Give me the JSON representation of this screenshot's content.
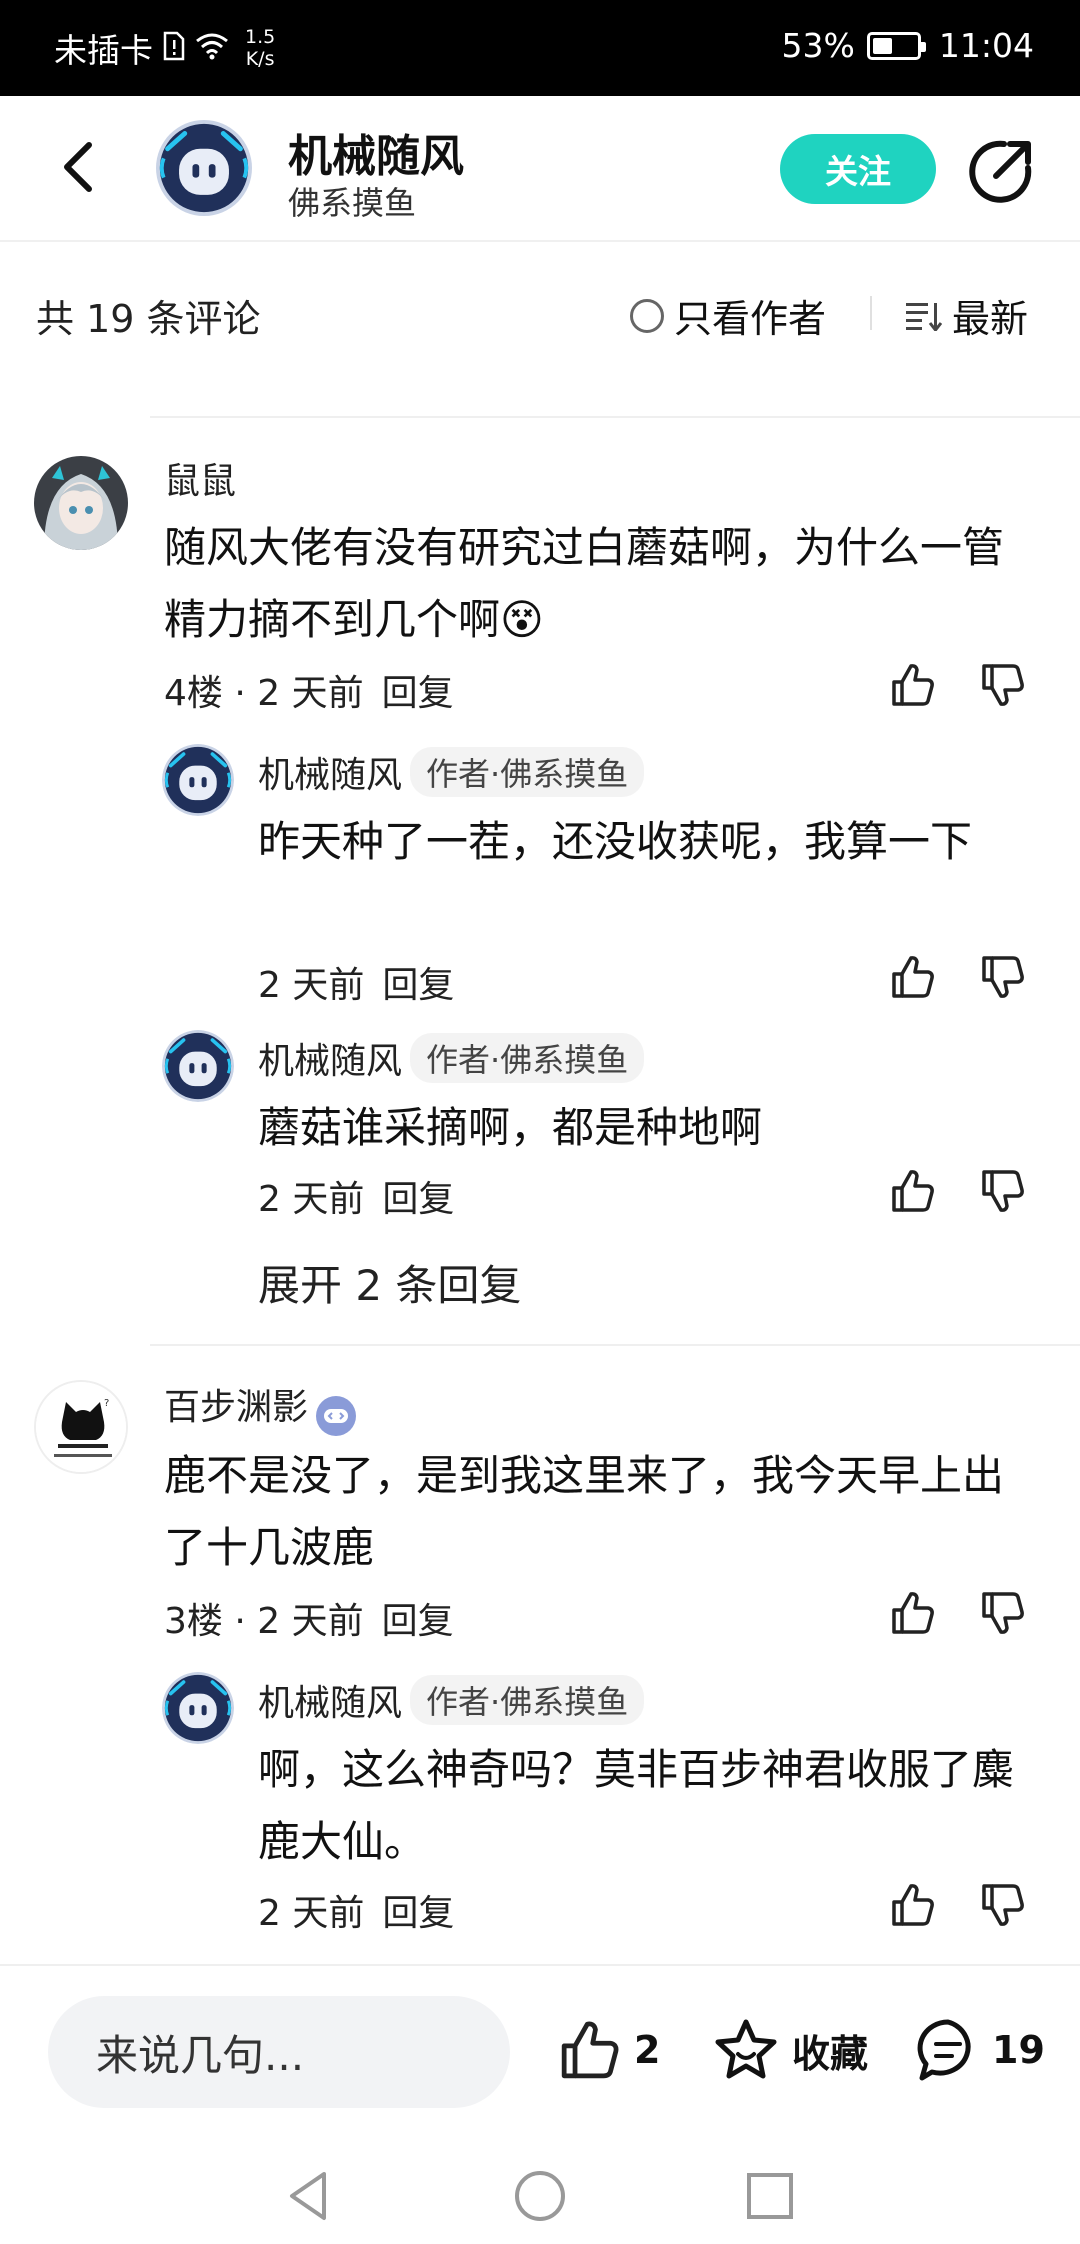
{
  "status_bar": {
    "carrier": "未插卡",
    "speed_value": "1.5",
    "speed_unit": "K/s",
    "battery": "53%",
    "battery_level": 0.53,
    "time": "11:04"
  },
  "header": {
    "title": "机械随风",
    "subtitle": "佛系摸鱼",
    "follow_label": "关注"
  },
  "comments_bar": {
    "count_label": "共 19 条评论",
    "author_only_label": "只看作者",
    "sort_label": "最新"
  },
  "comments": [
    {
      "name": "鼠鼠",
      "text": "随风大佬有没有研究过白蘑菇啊，为什么一管精力摘不到几个啊😵",
      "floor": "4楼",
      "time": "2 天前",
      "reply_label": "回复",
      "replies": [
        {
          "name": "机械随风",
          "badge": "作者·佛系摸鱼",
          "text": "昨天种了一茬，还没收获呢，我算一下",
          "time": "2 天前",
          "reply_label": "回复"
        },
        {
          "name": "机械随风",
          "badge": "作者·佛系摸鱼",
          "text": "蘑菇谁采摘啊，都是种地啊",
          "time": "2 天前",
          "reply_label": "回复"
        }
      ],
      "expand_label": "展开 2 条回复"
    },
    {
      "name": "百步渊影",
      "text": "鹿不是没了，是到我这里来了，我今天早上出了十几波鹿",
      "floor": "3楼",
      "time": "2 天前",
      "reply_label": "回复",
      "replies": [
        {
          "name": "机械随风",
          "badge": "作者·佛系摸鱼",
          "text": "啊，这么神奇吗？莫非百步神君收服了麋鹿大仙。",
          "time": "2 天前",
          "reply_label": "回复"
        }
      ]
    }
  ],
  "bottom_bar": {
    "input_placeholder": "来说几句...",
    "like_count": "2",
    "favorite_label": "收藏",
    "comment_count": "19"
  },
  "colors": {
    "accent": "#1fd3c0",
    "status_bar_bg": "#000000"
  },
  "icons": [
    "back-arrow-icon",
    "share-icon",
    "sort-icon",
    "thumb-up-icon",
    "thumb-down-icon",
    "star-icon",
    "comment-icon",
    "game-badge-icon"
  ]
}
